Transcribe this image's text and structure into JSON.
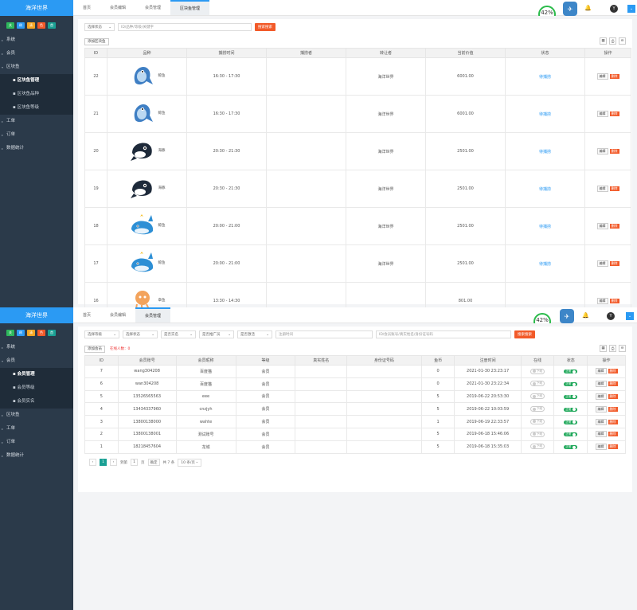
{
  "colors": {
    "accent": "#2b9af3",
    "sidebar": "#2b3a4a",
    "danger": "#f25a29",
    "success": "#22a95c"
  },
  "screen1": {
    "logo": "海洋世界",
    "quick": [
      {
        "label": "关",
        "color": "#2eb85c"
      },
      {
        "label": "刷",
        "color": "#2b9af3"
      },
      {
        "label": "清",
        "color": "#f5a623"
      },
      {
        "label": "色",
        "color": "#f25a29"
      },
      {
        "label": "首",
        "color": "#1aa094"
      }
    ],
    "nav": [
      {
        "label": "系统",
        "type": "top"
      },
      {
        "label": "会员",
        "type": "top"
      },
      {
        "label": "区块鱼",
        "type": "open"
      },
      {
        "label": "区块鱼管理",
        "type": "sub-active"
      },
      {
        "label": "区块鱼品种",
        "type": "sub"
      },
      {
        "label": "区块鱼等级",
        "type": "sub"
      },
      {
        "label": "工单",
        "type": "top"
      },
      {
        "label": "订单",
        "type": "top"
      },
      {
        "label": "数据统计",
        "type": "top"
      }
    ],
    "tabs": [
      "首页",
      "会员编辑",
      "会员管理",
      "区块鱼管理"
    ],
    "active_tab": 3,
    "badge": {
      "pct": "42%",
      "speed": "0.6K/s"
    },
    "avatar": "Y",
    "filter": {
      "status": "选择状态",
      "keyword_placeholder": "ID/品种/等级/关键字",
      "search": "搜索搜索"
    },
    "add_button": "添加区块鱼",
    "tools": [
      "▦",
      "⎙",
      "⊖"
    ],
    "columns": [
      "ID",
      "品种",
      "捕捞时间",
      "捕捞者",
      "转让者",
      "当前价值",
      "状态",
      "操作"
    ],
    "rows": [
      {
        "id": "22",
        "fish": "鲸鱼",
        "kind": "shark",
        "time": "16:30 - 17:30",
        "catcher": "",
        "owner": "海洋世界",
        "value": "6001.00",
        "status": "待捕捞"
      },
      {
        "id": "21",
        "fish": "鲸鱼",
        "kind": "shark",
        "time": "16:30 - 17:30",
        "catcher": "",
        "owner": "海洋世界",
        "value": "6001.00",
        "status": "待捕捞"
      },
      {
        "id": "20",
        "fish": "海豚",
        "kind": "orca",
        "time": "20:30 - 21:30",
        "catcher": "",
        "owner": "海洋世界",
        "value": "2501.00",
        "status": "待捕捞"
      },
      {
        "id": "19",
        "fish": "海豚",
        "kind": "orca",
        "time": "20:30 - 21:30",
        "catcher": "",
        "owner": "海洋世界",
        "value": "2501.00",
        "status": "待捕捞"
      },
      {
        "id": "18",
        "fish": "鲸鱼",
        "kind": "whale",
        "time": "20:00 - 21:00",
        "catcher": "",
        "owner": "海洋世界",
        "value": "2501.00",
        "status": "待捕捞"
      },
      {
        "id": "17",
        "fish": "鲸鱼",
        "kind": "whale",
        "time": "20:00 - 21:00",
        "catcher": "",
        "owner": "海洋世界",
        "value": "2501.00",
        "status": "待捕捞"
      },
      {
        "id": "16",
        "fish": "章鱼",
        "kind": "octo",
        "time": "13:30 - 14:30",
        "catcher": "",
        "owner": "",
        "value": "801.00",
        "status": ""
      }
    ],
    "edit": "编辑",
    "delete": "删除"
  },
  "screen2": {
    "logo": "海洋世界",
    "quick": [
      {
        "label": "关",
        "color": "#2eb85c"
      },
      {
        "label": "刷",
        "color": "#2b9af3"
      },
      {
        "label": "清",
        "color": "#f5a623"
      },
      {
        "label": "色",
        "color": "#f25a29"
      },
      {
        "label": "首",
        "color": "#1aa094"
      }
    ],
    "nav": [
      {
        "label": "系统",
        "type": "top"
      },
      {
        "label": "会员",
        "type": "open"
      },
      {
        "label": "会员管理",
        "type": "sub-active"
      },
      {
        "label": "会员等级",
        "type": "sub"
      },
      {
        "label": "会员实名",
        "type": "sub"
      },
      {
        "label": "区块鱼",
        "type": "top"
      },
      {
        "label": "工单",
        "type": "top"
      },
      {
        "label": "订单",
        "type": "top"
      },
      {
        "label": "数据统计",
        "type": "top"
      }
    ],
    "tabs": [
      "首页",
      "会员编辑",
      "会员管理"
    ],
    "active_tab": 2,
    "badge": {
      "pct": "42%",
      "speed": "2.7M/s"
    },
    "avatar": "Y",
    "filters": [
      "选择等级",
      "选择状态",
      "是否实名",
      "是否推广员",
      "是否激活"
    ],
    "reg_time_placeholder": "注册时间",
    "keyword_placeholder": "ID/会员账号/真实姓名/身份证号码",
    "search": "搜索搜索",
    "add_button": "添加会员",
    "online_text": "在线人数：0",
    "tools": [
      "▦",
      "⎙",
      "⊖"
    ],
    "columns": [
      "ID",
      "会员账号",
      "会员昵称",
      "等级",
      "真实姓名",
      "身份证号码",
      "鱼币",
      "注册时间",
      "在线",
      "状态",
      "操作"
    ],
    "rows": [
      {
        "id": "7",
        "account": "wang304208",
        "nick": "百度猫",
        "level": "会员",
        "real": "",
        "idno": "",
        "coin": "0",
        "reg": "2021-01-30 23:23:17",
        "online": "下线",
        "status": "正常"
      },
      {
        "id": "6",
        "account": "wan304208",
        "nick": "百度猫",
        "level": "会员",
        "real": "",
        "idno": "",
        "coin": "0",
        "reg": "2021-01-30 23:22:34",
        "online": "下线",
        "status": "正常"
      },
      {
        "id": "5",
        "account": "13526565563",
        "nick": "eee",
        "level": "会员",
        "real": "",
        "idno": "",
        "coin": "5",
        "reg": "2019-06-22 20:53:30",
        "online": "下线",
        "status": "正常"
      },
      {
        "id": "4",
        "account": "13434337960",
        "nick": "cnzjyh",
        "level": "会员",
        "real": "",
        "idno": "",
        "coin": "5",
        "reg": "2019-06-22 10:03:59",
        "online": "下线",
        "status": "正常"
      },
      {
        "id": "3",
        "account": "13800138000",
        "nick": "wahte",
        "level": "会员",
        "real": "",
        "idno": "",
        "coin": "1",
        "reg": "2019-06-19 22:33:57",
        "online": "下线",
        "status": "正常"
      },
      {
        "id": "2",
        "account": "13800138001",
        "nick": "测试账号",
        "level": "会员",
        "real": "",
        "idno": "",
        "coin": "5",
        "reg": "2019-06-18 15:46:06",
        "online": "下线",
        "status": "正常"
      },
      {
        "id": "1",
        "account": "18218457604",
        "nick": "龙城",
        "level": "会员",
        "real": "",
        "idno": "",
        "coin": "5",
        "reg": "2019-06-18 15:35:03",
        "online": "下线",
        "status": "正常"
      }
    ],
    "edit": "编辑",
    "delete": "删除",
    "pager": {
      "prev": "‹",
      "page": "1",
      "next": "›",
      "goto": "到第",
      "goto_value": "1",
      "page_unit": "页",
      "confirm": "确定",
      "total": "共 7 条",
      "per_page": "10 条/页"
    }
  }
}
